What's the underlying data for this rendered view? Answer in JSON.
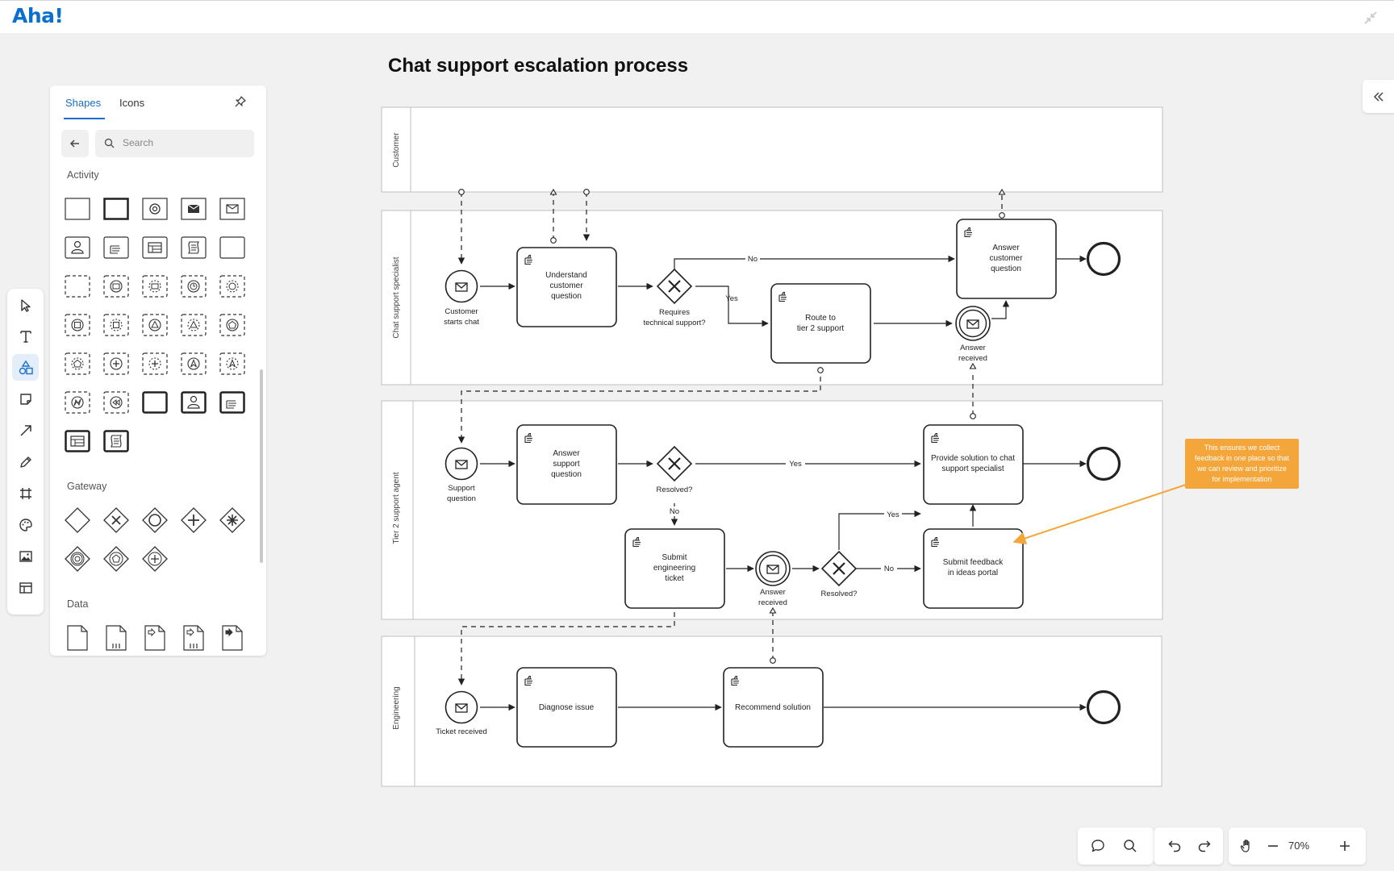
{
  "app": {
    "logo_text": "Aha!"
  },
  "document": {
    "title": "Chat support escalation process"
  },
  "shapes_panel": {
    "tabs": [
      "Shapes",
      "Icons"
    ],
    "active_tab": "Shapes",
    "search_placeholder": "Search",
    "sections": {
      "activity": "Activity",
      "gateway": "Gateway",
      "data": "Data"
    }
  },
  "toolbar": {
    "tools": [
      "select-tool",
      "text-tool",
      "shapes-tool",
      "sticky-note-tool",
      "arrow-tool",
      "pen-tool",
      "frame-tool",
      "palette-tool",
      "image-tool",
      "template-tool"
    ],
    "active": "shapes-tool"
  },
  "zoom": {
    "level": "70%"
  },
  "diagram": {
    "lanes": [
      "Customer",
      "Chat support specialist",
      "Tier 2 support agent",
      "Engineering"
    ],
    "tasks": {
      "understand": "Understand customer question",
      "route": "Route to tier 2 support",
      "answer_customer": "Answer customer question",
      "answer_support": "Answer support question",
      "provide_solution": "Provide solution to chat support specialist",
      "submit_ticket": "Submit engineering ticket",
      "submit_feedback": "Submit feedback in ideas portal",
      "diagnose": "Diagnose issue",
      "recommend": "Recommend solution"
    },
    "events": {
      "customer_starts_chat": "Customer starts chat",
      "answer_received_1": "Answer received",
      "support_question": "Support question",
      "answer_received_2": "Answer received",
      "ticket_received": "Ticket received"
    },
    "gateways": {
      "requires_support": "Requires technical support?",
      "resolved_1": "Resolved?",
      "resolved_2": "Resolved?"
    },
    "flow_labels": {
      "no": "No",
      "yes": "Yes"
    },
    "note": "This ensures we collect feedback in one place so that we can review and prioritize for implementation"
  },
  "colors": {
    "accent": "#1a6fc6",
    "note": "#f5a63a",
    "logo": "#0a6fd0"
  }
}
